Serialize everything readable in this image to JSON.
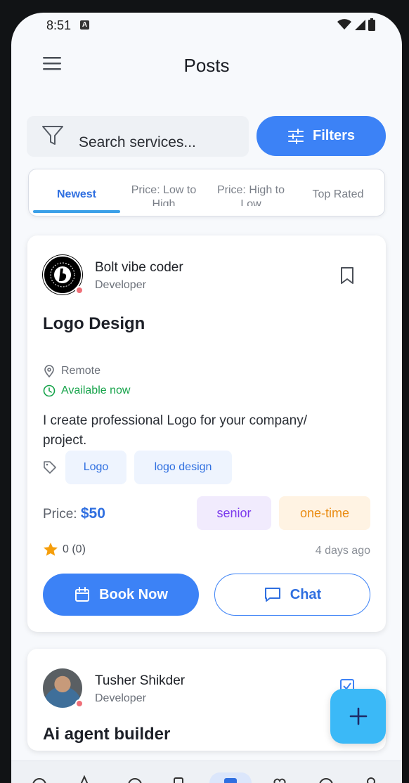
{
  "status_bar": {
    "time": "8:51",
    "notification_glyph": "A"
  },
  "header": {
    "title": "Posts",
    "menu_icon": "hamburger-icon"
  },
  "search": {
    "placeholder": "Search services...",
    "filter_icon": "funnel-icon"
  },
  "filters_button": {
    "label": "Filters",
    "icon": "sliders-icon"
  },
  "sort_tabs": [
    {
      "label": "Newest",
      "active": true
    },
    {
      "label": "Price: Low to High",
      "active": false
    },
    {
      "label": "Price: High to Low",
      "active": false
    },
    {
      "label": "Top Rated",
      "active": false
    }
  ],
  "posts": [
    {
      "poster_name": "Bolt vibe coder",
      "poster_role": "Developer",
      "title": "Logo Design",
      "location": "Remote",
      "availability": "Available now",
      "description": "I create professional Logo for your company/ project.",
      "tags": [
        "Logo",
        "logo design"
      ],
      "price_label": "Price:",
      "price": "$50",
      "level": "senior",
      "payment_type": "one-time",
      "rating": "0 (0)",
      "posted": "4 days ago",
      "book_label": "Book Now",
      "chat_label": "Chat"
    },
    {
      "poster_name": "Tusher Shikder",
      "poster_role": "Developer",
      "title": "Ai agent builder"
    }
  ],
  "colors": {
    "primary": "#3c82f6",
    "fab": "#3bb9f7",
    "available": "#16a34a",
    "senior_badge": "#7c3aed",
    "one_time_badge": "#ea8c12",
    "star": "#f59e0b",
    "online_dot": "#ef6f78"
  }
}
